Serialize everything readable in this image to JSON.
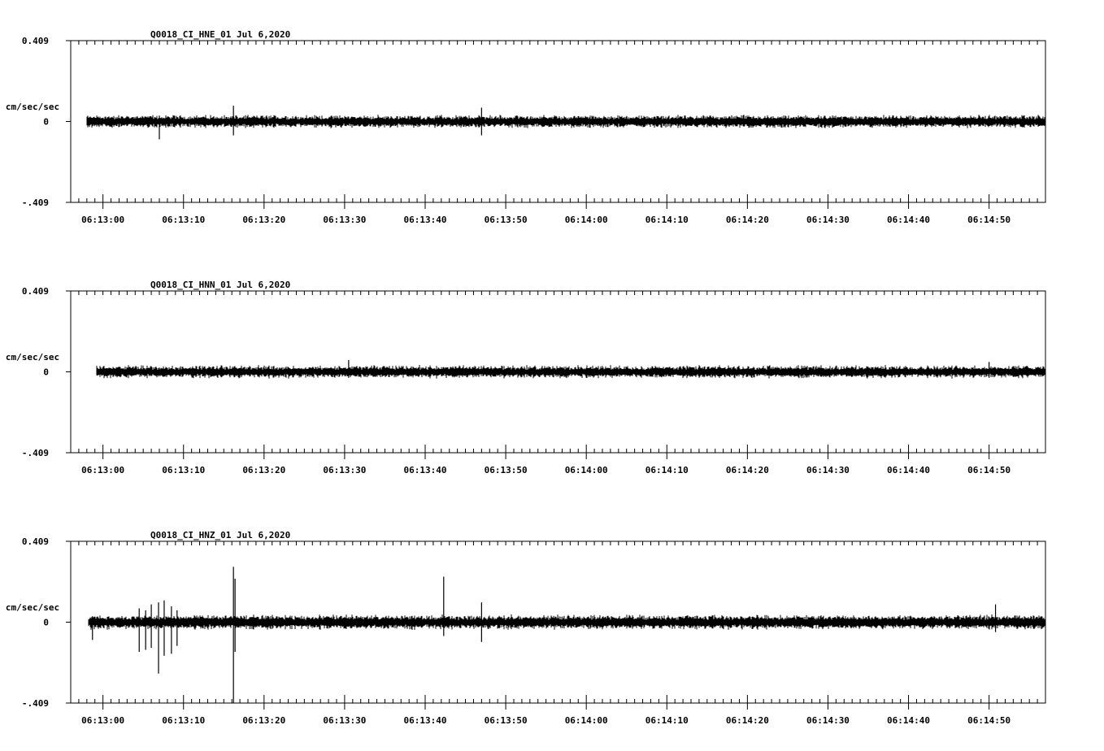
{
  "chart_data": [
    {
      "type": "line",
      "title": "Q0018_CI_HNE_01  Jul 6,2020",
      "ylabel": "cm/sec/sec",
      "ylim": [
        -0.409,
        0.409
      ],
      "ytick_labels": [
        "0.409",
        "0",
        "-.409"
      ],
      "xtick_labels": [
        "06:13:00",
        "06:13:10",
        "06:13:20",
        "06:13:30",
        "06:13:40",
        "06:13:50",
        "06:14:00",
        "06:14:10",
        "06:14:20",
        "06:14:30",
        "06:14:40",
        "06:14:50"
      ],
      "xlim": [
        -4.0,
        117.0
      ],
      "data_start": -2.0,
      "noise_amplitude": 0.035,
      "spikes": [
        {
          "t": 7.0,
          "min": -0.09,
          "max": 0.03
        },
        {
          "t": 16.2,
          "min": -0.07,
          "max": 0.08
        },
        {
          "t": 47.0,
          "min": -0.07,
          "max": 0.07
        }
      ]
    },
    {
      "type": "line",
      "title": "Q0018_CI_HNN_01  Jul 6,2020",
      "ylabel": "cm/sec/sec",
      "ylim": [
        -0.409,
        0.409
      ],
      "ytick_labels": [
        "0.409",
        "0",
        "-.409"
      ],
      "xtick_labels": [
        "06:13:00",
        "06:13:10",
        "06:13:20",
        "06:13:30",
        "06:13:40",
        "06:13:50",
        "06:14:00",
        "06:14:10",
        "06:14:20",
        "06:14:30",
        "06:14:40",
        "06:14:50"
      ],
      "xlim": [
        -4.0,
        117.0
      ],
      "data_start": -0.8,
      "noise_amplitude": 0.035,
      "spikes": [
        {
          "t": 30.5,
          "min": -0.03,
          "max": 0.06
        },
        {
          "t": 110.0,
          "min": -0.03,
          "max": 0.05
        }
      ]
    },
    {
      "type": "line",
      "title": "Q0018_CI_HNZ_01  Jul 6,2020",
      "ylabel": "cm/sec/sec",
      "ylim": [
        -0.409,
        0.409
      ],
      "ytick_labels": [
        "0.409",
        "0",
        "-.409"
      ],
      "xtick_labels": [
        "06:13:00",
        "06:13:10",
        "06:13:20",
        "06:13:30",
        "06:13:40",
        "06:13:50",
        "06:14:00",
        "06:14:10",
        "06:14:20",
        "06:14:30",
        "06:14:40",
        "06:14:50"
      ],
      "xlim": [
        -4.0,
        117.0
      ],
      "data_start": -1.8,
      "noise_amplitude": 0.04,
      "spikes": [
        {
          "t": -1.3,
          "min": -0.09,
          "max": 0.03
        },
        {
          "t": 4.5,
          "min": -0.15,
          "max": 0.07
        },
        {
          "t": 5.3,
          "min": -0.14,
          "max": 0.06
        },
        {
          "t": 6.0,
          "min": -0.13,
          "max": 0.09
        },
        {
          "t": 6.9,
          "min": -0.26,
          "max": 0.1
        },
        {
          "t": 7.6,
          "min": -0.17,
          "max": 0.11
        },
        {
          "t": 8.5,
          "min": -0.16,
          "max": 0.08
        },
        {
          "t": 9.2,
          "min": -0.12,
          "max": 0.06
        },
        {
          "t": 16.2,
          "min": -0.409,
          "max": 0.28
        },
        {
          "t": 16.4,
          "min": -0.15,
          "max": 0.22
        },
        {
          "t": 42.3,
          "min": -0.07,
          "max": 0.23
        },
        {
          "t": 47.0,
          "min": -0.1,
          "max": 0.1
        },
        {
          "t": 110.8,
          "min": -0.05,
          "max": 0.09
        }
      ]
    }
  ]
}
